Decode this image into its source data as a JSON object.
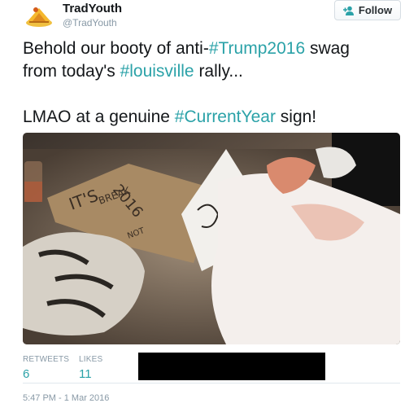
{
  "user": {
    "name": "TradYouth",
    "handle": "@TradYouth"
  },
  "follow_button": {
    "label": "Follow",
    "icon": "add-user-icon"
  },
  "tweet": {
    "line1_pre": "Behold our booty of anti-",
    "line1_tag": "#Trump2016",
    "line1_post": " swag",
    "line2_pre": "from today's ",
    "line2_tag": "#louisville",
    "line2_post": " rally...",
    "line3_pre": "LMAO at a genuine ",
    "line3_tag": "#CurrentYear",
    "line3_post": " sign!"
  },
  "media": {
    "sign_text_1": "IT'S",
    "sign_text_2": "2016",
    "sign_text_3": "BREAK",
    "sign_text_4": "NOT"
  },
  "stats": {
    "retweets_label": "RETWEETS",
    "retweets_value": "6",
    "likes_label": "LIKES",
    "likes_value": "11"
  },
  "timestamp": "5:47 PM - 1 Mar 2016",
  "colors": {
    "hashtag": "#2ba2a8",
    "muted": "#8899a6"
  }
}
